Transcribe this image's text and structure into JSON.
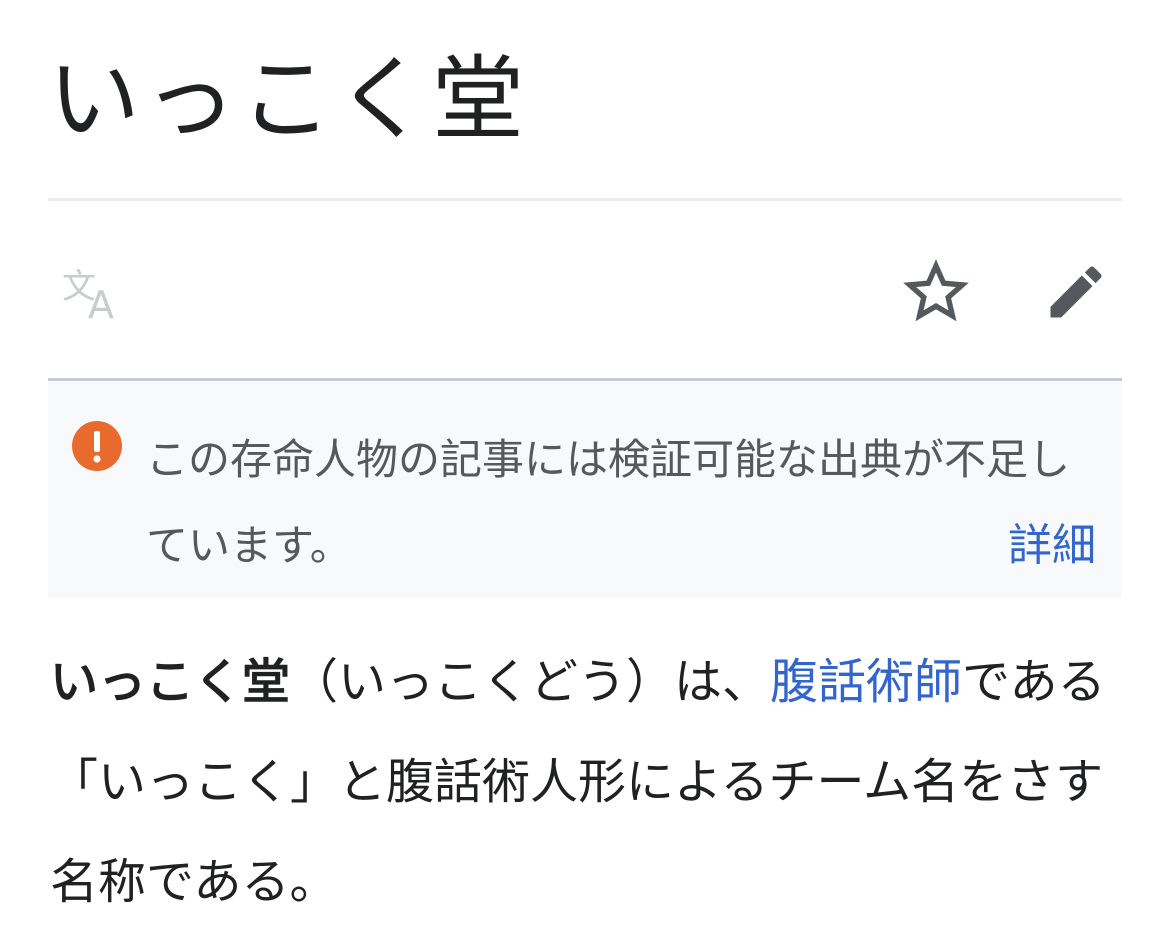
{
  "article": {
    "title": "いっこく堂"
  },
  "toolbar": {
    "language_icon": "language-icon",
    "watch_icon": "star-icon",
    "edit_icon": "pencil-icon"
  },
  "notice": {
    "icon": "exclamation-icon",
    "text": "この存命人物の記事には検証可能な出典が不足しています。",
    "details_link": "詳細",
    "accent_color": "#e86a2c"
  },
  "lead": {
    "bold_name": "いっこく堂",
    "reading": "（いっこくどう）は、",
    "link_text": "腹話術師",
    "rest": "である「いっこく」と腹話術人形によるチーム名をさす名称である。"
  },
  "colors": {
    "link": "#3366cc",
    "text": "#202122",
    "notice_bg": "#f8f9fa"
  }
}
